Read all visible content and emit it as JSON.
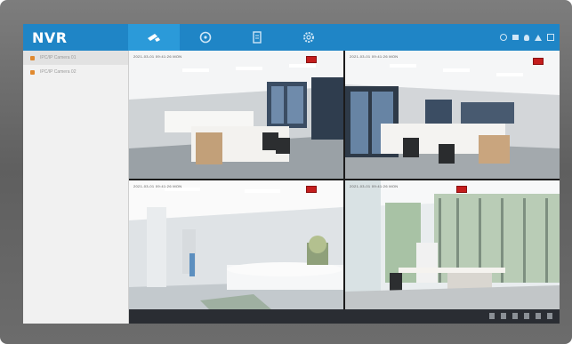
{
  "app": {
    "title": "NVR"
  },
  "nav": {
    "tabs": [
      {
        "icon": "camera-icon",
        "active": true
      },
      {
        "icon": "playback-icon",
        "active": false
      },
      {
        "icon": "file-icon",
        "active": false
      },
      {
        "icon": "settings-icon",
        "active": false
      }
    ]
  },
  "tray": {
    "icons": [
      "info-icon",
      "screen-icon",
      "user-icon",
      "alarm-icon",
      "exit-icon"
    ]
  },
  "sidebar": {
    "cameras": [
      {
        "label": "IPC/IP Camera 01"
      },
      {
        "label": "IPC/IP Camera 02"
      }
    ]
  },
  "tiles": [
    {
      "osd": "2021-03-01  09:41:26  MON",
      "recording": true
    },
    {
      "osd": "2021-03-01  09:41:26  MON",
      "recording": true
    },
    {
      "osd": "2021-03-01  09:41:26  MON",
      "recording": true
    },
    {
      "osd": "2021-03-01  09:41:26  MON",
      "recording": true
    }
  ],
  "colors": {
    "topbar": "#1f85c6",
    "rec": "#c41d1d",
    "sidebar": "#f1f1f1"
  }
}
